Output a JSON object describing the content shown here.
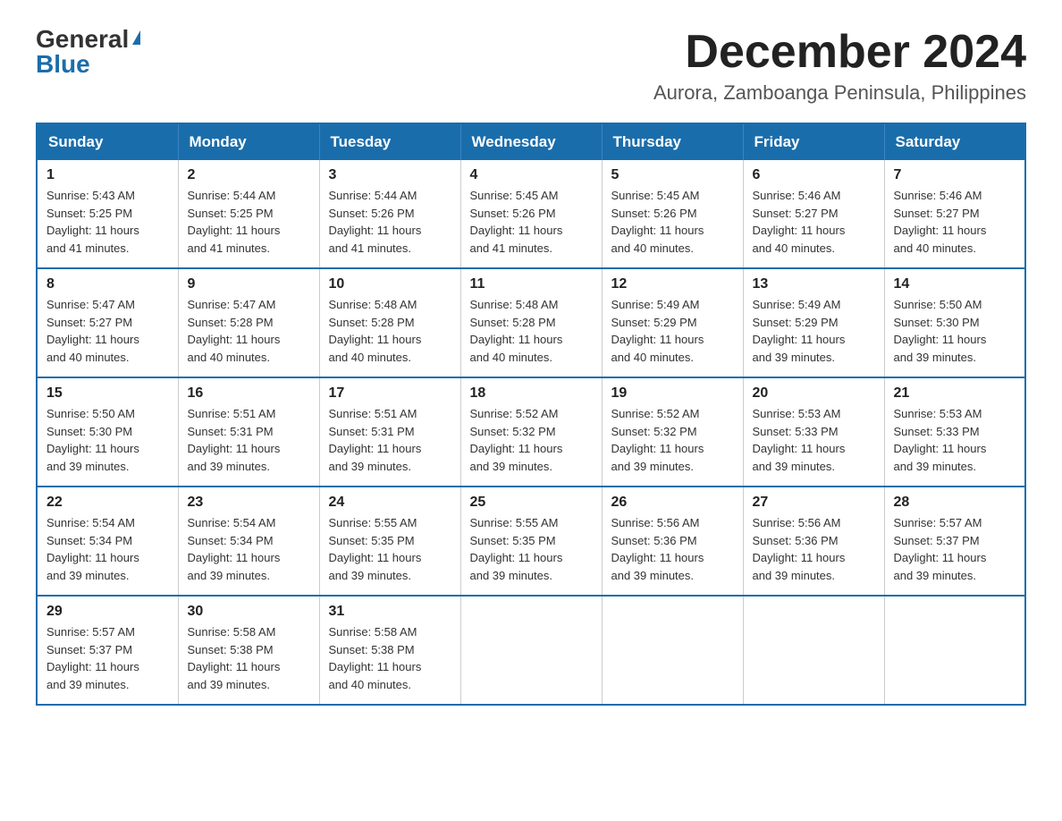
{
  "logo": {
    "general": "General",
    "blue": "Blue"
  },
  "header": {
    "month": "December 2024",
    "location": "Aurora, Zamboanga Peninsula, Philippines"
  },
  "days_of_week": [
    "Sunday",
    "Monday",
    "Tuesday",
    "Wednesday",
    "Thursday",
    "Friday",
    "Saturday"
  ],
  "weeks": [
    [
      {
        "day": "1",
        "sunrise": "5:43 AM",
        "sunset": "5:25 PM",
        "daylight": "11 hours and 41 minutes."
      },
      {
        "day": "2",
        "sunrise": "5:44 AM",
        "sunset": "5:25 PM",
        "daylight": "11 hours and 41 minutes."
      },
      {
        "day": "3",
        "sunrise": "5:44 AM",
        "sunset": "5:26 PM",
        "daylight": "11 hours and 41 minutes."
      },
      {
        "day": "4",
        "sunrise": "5:45 AM",
        "sunset": "5:26 PM",
        "daylight": "11 hours and 41 minutes."
      },
      {
        "day": "5",
        "sunrise": "5:45 AM",
        "sunset": "5:26 PM",
        "daylight": "11 hours and 40 minutes."
      },
      {
        "day": "6",
        "sunrise": "5:46 AM",
        "sunset": "5:27 PM",
        "daylight": "11 hours and 40 minutes."
      },
      {
        "day": "7",
        "sunrise": "5:46 AM",
        "sunset": "5:27 PM",
        "daylight": "11 hours and 40 minutes."
      }
    ],
    [
      {
        "day": "8",
        "sunrise": "5:47 AM",
        "sunset": "5:27 PM",
        "daylight": "11 hours and 40 minutes."
      },
      {
        "day": "9",
        "sunrise": "5:47 AM",
        "sunset": "5:28 PM",
        "daylight": "11 hours and 40 minutes."
      },
      {
        "day": "10",
        "sunrise": "5:48 AM",
        "sunset": "5:28 PM",
        "daylight": "11 hours and 40 minutes."
      },
      {
        "day": "11",
        "sunrise": "5:48 AM",
        "sunset": "5:28 PM",
        "daylight": "11 hours and 40 minutes."
      },
      {
        "day": "12",
        "sunrise": "5:49 AM",
        "sunset": "5:29 PM",
        "daylight": "11 hours and 40 minutes."
      },
      {
        "day": "13",
        "sunrise": "5:49 AM",
        "sunset": "5:29 PM",
        "daylight": "11 hours and 39 minutes."
      },
      {
        "day": "14",
        "sunrise": "5:50 AM",
        "sunset": "5:30 PM",
        "daylight": "11 hours and 39 minutes."
      }
    ],
    [
      {
        "day": "15",
        "sunrise": "5:50 AM",
        "sunset": "5:30 PM",
        "daylight": "11 hours and 39 minutes."
      },
      {
        "day": "16",
        "sunrise": "5:51 AM",
        "sunset": "5:31 PM",
        "daylight": "11 hours and 39 minutes."
      },
      {
        "day": "17",
        "sunrise": "5:51 AM",
        "sunset": "5:31 PM",
        "daylight": "11 hours and 39 minutes."
      },
      {
        "day": "18",
        "sunrise": "5:52 AM",
        "sunset": "5:32 PM",
        "daylight": "11 hours and 39 minutes."
      },
      {
        "day": "19",
        "sunrise": "5:52 AM",
        "sunset": "5:32 PM",
        "daylight": "11 hours and 39 minutes."
      },
      {
        "day": "20",
        "sunrise": "5:53 AM",
        "sunset": "5:33 PM",
        "daylight": "11 hours and 39 minutes."
      },
      {
        "day": "21",
        "sunrise": "5:53 AM",
        "sunset": "5:33 PM",
        "daylight": "11 hours and 39 minutes."
      }
    ],
    [
      {
        "day": "22",
        "sunrise": "5:54 AM",
        "sunset": "5:34 PM",
        "daylight": "11 hours and 39 minutes."
      },
      {
        "day": "23",
        "sunrise": "5:54 AM",
        "sunset": "5:34 PM",
        "daylight": "11 hours and 39 minutes."
      },
      {
        "day": "24",
        "sunrise": "5:55 AM",
        "sunset": "5:35 PM",
        "daylight": "11 hours and 39 minutes."
      },
      {
        "day": "25",
        "sunrise": "5:55 AM",
        "sunset": "5:35 PM",
        "daylight": "11 hours and 39 minutes."
      },
      {
        "day": "26",
        "sunrise": "5:56 AM",
        "sunset": "5:36 PM",
        "daylight": "11 hours and 39 minutes."
      },
      {
        "day": "27",
        "sunrise": "5:56 AM",
        "sunset": "5:36 PM",
        "daylight": "11 hours and 39 minutes."
      },
      {
        "day": "28",
        "sunrise": "5:57 AM",
        "sunset": "5:37 PM",
        "daylight": "11 hours and 39 minutes."
      }
    ],
    [
      {
        "day": "29",
        "sunrise": "5:57 AM",
        "sunset": "5:37 PM",
        "daylight": "11 hours and 39 minutes."
      },
      {
        "day": "30",
        "sunrise": "5:58 AM",
        "sunset": "5:38 PM",
        "daylight": "11 hours and 39 minutes."
      },
      {
        "day": "31",
        "sunrise": "5:58 AM",
        "sunset": "5:38 PM",
        "daylight": "11 hours and 40 minutes."
      },
      null,
      null,
      null,
      null
    ]
  ],
  "labels": {
    "sunrise": "Sunrise:",
    "sunset": "Sunset:",
    "daylight": "Daylight:"
  }
}
